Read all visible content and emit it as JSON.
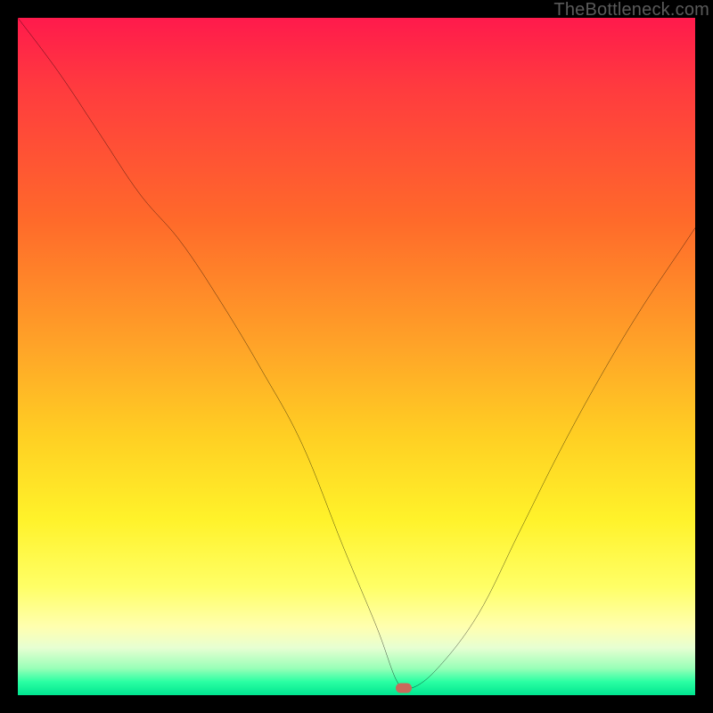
{
  "watermark": "TheBottleneck.com",
  "marker": {
    "x_pct": 57,
    "y_pct": 99
  },
  "chart_data": {
    "type": "line",
    "title": "",
    "xlabel": "",
    "ylabel": "",
    "xlim": [
      0,
      100
    ],
    "ylim": [
      0,
      100
    ],
    "grid": false,
    "legend": false,
    "series": [
      {
        "name": "curve",
        "x": [
          0,
          6,
          12,
          18,
          24,
          30,
          36,
          42,
          48,
          53,
          56,
          58,
          62,
          68,
          74,
          80,
          86,
          92,
          98,
          100
        ],
        "y": [
          100,
          92,
          83,
          74,
          67,
          58,
          48,
          37,
          22,
          10,
          2,
          1,
          4,
          12,
          24,
          36,
          47,
          57,
          66,
          69
        ]
      }
    ],
    "annotations": [
      {
        "type": "marker",
        "x": 57,
        "y": 1,
        "label": "current-point"
      }
    ]
  }
}
